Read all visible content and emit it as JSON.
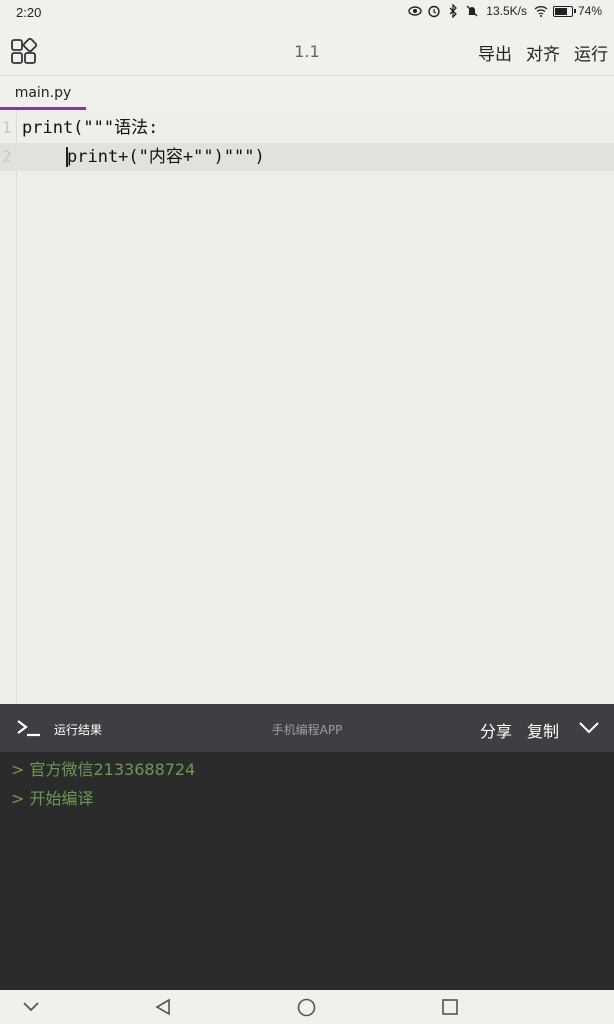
{
  "status_bar": {
    "time": "2:20",
    "network_speed": "13.5K/s",
    "battery": "74%",
    "icons": [
      "eye-icon",
      "alarm-icon",
      "bluetooth-icon",
      "mute-icon",
      "wifi-icon",
      "battery-icon"
    ]
  },
  "toolbar": {
    "menu_icon": "apps-grid-icon",
    "version": "1.1",
    "export_label": "导出",
    "align_label": "对齐",
    "run_label": "运行"
  },
  "tabs": [
    {
      "label": "main.py",
      "active": true
    }
  ],
  "editor": {
    "lines": [
      {
        "number": "1",
        "code": "print(\"\"\"语法:"
      },
      {
        "number": "2",
        "code": "print+(\"内容+\"\")\"\"\")"
      }
    ]
  },
  "result_panel": {
    "terminal_icon": "terminal-icon",
    "title": "运行结果",
    "app_name": "手机编程APP",
    "share_label": "分享",
    "copy_label": "复制",
    "collapse_icon": "chevron-down-icon",
    "output": [
      "> 官方微信2133688724",
      "> 开始编译"
    ]
  },
  "nav_bar": {
    "icons": [
      "hide-keyboard-icon",
      "back-icon",
      "home-icon",
      "recents-icon"
    ]
  },
  "colors": {
    "background": "#f1f0ec",
    "tab_accent": "#7d3f8c",
    "panel_header": "#3d3f42",
    "console_bg": "#2b2b2b",
    "console_text": "#6a9a55"
  }
}
